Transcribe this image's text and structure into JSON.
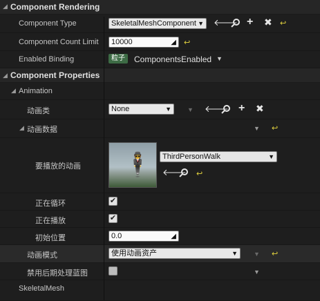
{
  "sections": {
    "rendering": "Component Rendering",
    "properties": "Component Properties"
  },
  "component_type": {
    "label": "Component Type",
    "value": "SkeletalMeshComponent"
  },
  "count_limit": {
    "label": "Component Count Limit",
    "value": "10000"
  },
  "enabled_binding": {
    "label": "Enabled Binding",
    "tag": "粒子",
    "value": "ComponentsEnabled"
  },
  "animation": {
    "group_label": "Animation",
    "anim_class": {
      "label": "动画类",
      "value": "None"
    },
    "anim_data": {
      "label": "动画数据"
    },
    "anim_to_play": {
      "label": "要播放的动画",
      "value": "ThirdPersonWalk"
    },
    "looping": {
      "label": "正在循环",
      "checked": true
    },
    "playing": {
      "label": "正在播放",
      "checked": true
    },
    "initial_position": {
      "label": "初始位置",
      "value": "0.0"
    },
    "anim_mode": {
      "label": "动画模式",
      "value": "使用动画资产"
    },
    "disable_post_process": {
      "label": "禁用后期处理蓝图",
      "checked": false
    }
  },
  "skeletal_mesh": {
    "label": "SkeletalMesh"
  },
  "icons": {
    "arrow": "↩",
    "browse": "search",
    "add": "plus",
    "clear": "x",
    "reset": "yellow-reset-arrow"
  }
}
